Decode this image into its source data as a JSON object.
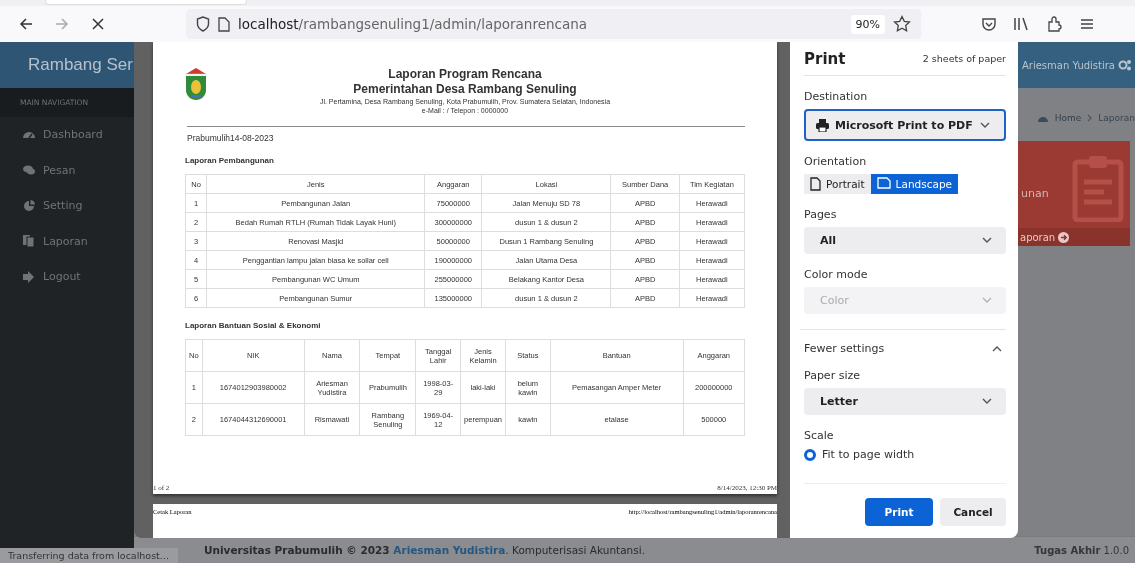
{
  "browser": {
    "url": {
      "host": "localhost",
      "path": "/rambangsenuling1/admin/laporanrencana"
    },
    "zoom": "90%",
    "status": "Transferring data from localhost..."
  },
  "app": {
    "brand": "Rambang Ser",
    "nav_header": "MAIN NAVIGATION",
    "menu": [
      {
        "label": "Dashboard",
        "kind": "dashboard"
      },
      {
        "label": "Pesan",
        "kind": "messages"
      },
      {
        "label": "Setting",
        "kind": "chart"
      },
      {
        "label": "Laporan",
        "kind": "files"
      },
      {
        "label": "Logout",
        "kind": "logout"
      }
    ],
    "user": "Ariesman Yudistira",
    "breadcrumb": [
      "Home",
      "Laporan"
    ],
    "card": {
      "text": "unan",
      "link": "aporan"
    },
    "footer": {
      "lead": "Universitas Prabumulih © 2023",
      "link": "Ariesman Yudistira",
      "tail": ". Komputerisasi Akuntansi."
    },
    "version": "**Tugas Akhir** 1.0.0"
  },
  "preview": {
    "report": {
      "title": "Laporan Program Rencana",
      "subtitle": "Pemerintahan Desa Rambang Senuling",
      "address": "Jl. Pertamina, Desa Rambang Senuling, Kota Prabumulih, Prov. Sumatera Selatan, Indonesia",
      "contact": "e-Mail : / Telepon : 0000000",
      "place_date": "Prabumulih14-08-2023",
      "sections": [
        {
          "heading": "Laporan Pembangunan",
          "columns": [
            "No",
            "Jenis",
            "Anggaran",
            "Lokasi",
            "Sumber Dana",
            "Tim Kegiatan"
          ],
          "rows": [
            [
              "1",
              "Pembangunan Jalan",
              "75000000",
              "Jalan Menuju SD 78",
              "APBD",
              "Herawadi"
            ],
            [
              "2",
              "Bedah Rumah RTLH (Rumah Tidak Layak Huni)",
              "300000000",
              "dusun 1 & dusun 2",
              "APBD",
              "Herawadi"
            ],
            [
              "3",
              "Renovasi Masjid",
              "50000000",
              "Dusun 1 Rambang Senuling",
              "APBD",
              "Herawadi"
            ],
            [
              "4",
              "Penggantian lampu jalan biasa ke sollar cell",
              "190000000",
              "Jalan Utama Desa",
              "APBD",
              "Herawadi"
            ],
            [
              "5",
              "Pembangunan WC Umum",
              "255000000",
              "Belakang Kantor Desa",
              "APBD",
              "Herawadi"
            ],
            [
              "6",
              "Pembangunan Sumur",
              "135000000",
              "dusun 1 & dusun 2",
              "APBD",
              "Herawadi"
            ]
          ]
        },
        {
          "heading": "Laporan Bantuan Sosial & Ekonomi",
          "columns": [
            "No",
            "NIK",
            "Nama",
            "Tempat",
            "Tanggal Lahir",
            "Jenis Kelamin",
            "Status",
            "Bantuan",
            "Anggaran"
          ],
          "rows": [
            [
              "1",
              "1674012903980002",
              "Ariesman Yudistira",
              "Prabumulih",
              "1998-03-29",
              "laki-laki",
              "belum kawin",
              "Pemasangan Amper Meter",
              "200000000"
            ],
            [
              "2",
              "1674044312690001",
              "Rismawati",
              "Rambang Senuling",
              "1969-04-12",
              "perempuan",
              "kawin",
              "etalase",
              "500000"
            ]
          ]
        }
      ]
    },
    "page_footer": {
      "page": "1 of 2",
      "timestamp": "8/14/2023, 12:30 PM"
    },
    "next_page_header": {
      "title": "Cetak Laporan",
      "url": "http://localhost/rambangsenuling1/admin/laporanrencana"
    }
  },
  "print_dialog": {
    "title": "Print",
    "sheets": "2 sheets of paper",
    "destination": {
      "label": "Destination",
      "value": "Microsoft Print to PDF",
      "focused": true
    },
    "orientation": {
      "label": "Orientation",
      "options": [
        {
          "label": "Portrait",
          "selected": false
        },
        {
          "label": "Landscape",
          "selected": true
        }
      ]
    },
    "pages": {
      "label": "Pages",
      "value": "All"
    },
    "color_mode": {
      "label": "Color mode",
      "value": "Color",
      "disabled": true
    },
    "more_settings": {
      "label": "Fewer settings",
      "expanded": true
    },
    "paper_size": {
      "label": "Paper size",
      "value": "Letter"
    },
    "scale": {
      "label": "Scale",
      "options": [
        {
          "label": "Fit to page width",
          "selected": true
        }
      ]
    },
    "buttons": [
      {
        "label": "Print",
        "kind": "primary"
      },
      {
        "label": "Cancel",
        "kind": "secondary"
      }
    ]
  }
}
